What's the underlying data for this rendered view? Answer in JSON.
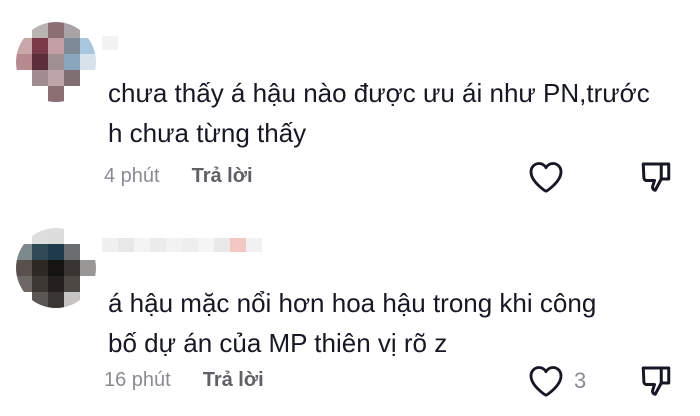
{
  "comments": [
    {
      "text_lines": [
        "chưa thấy á hậu nào được ưu ái như PN,trước",
        "h chưa từng thấy"
      ],
      "time": "4 phút",
      "reply_label": "Trả lời",
      "like_count": ""
    },
    {
      "text_lines": [
        "á hậu mặc nổi hơn hoa hậu trong khi công",
        "bố dự án của MP thiên vị rõ z"
      ],
      "time": "16 phút",
      "reply_label": "Trả lời",
      "like_count": "3"
    }
  ],
  "colors": {
    "text": "#161823",
    "meta": "#8a8b91",
    "reply": "#5f6066",
    "icon": "#161823"
  },
  "avatars": {
    "c1": [
      "#ffffff",
      "#b9b4b2",
      "#8d6f73",
      "#a9a2a6",
      "#ffffff",
      "#c9a6a8",
      "#7a3a48",
      "#c39ea4",
      "#7f8a99",
      "#a9c8e0",
      "#b68a8e",
      "#5c2e3a",
      "#9f8f93",
      "#8aa6bd",
      "#d7e2ea",
      "#ffffff",
      "#a08c91",
      "#bda4a8",
      "#7f6f73",
      "#ffffff",
      "#ffffff",
      "#ffffff",
      "#8c6f73",
      "#ffffff",
      "#ffffff"
    ],
    "c2": [
      "#ffffff",
      "#dedede",
      "#dcdcdc",
      "#ffffff",
      "#ffffff",
      "#7c8a8c",
      "#2f4a55",
      "#1f3a4a",
      "#6a6e70",
      "#ffffff",
      "#58504c",
      "#2e2825",
      "#161412",
      "#3a3432",
      "#9a9896",
      "#6c6866",
      "#3e3835",
      "#25201e",
      "#4e4845",
      "#ffffff",
      "#ffffff",
      "#5a5654",
      "#3a3634",
      "#c6c4c2",
      "#ffffff"
    ]
  },
  "usernames": {
    "c1": [
      "#f2f2f2",
      "#ffffff"
    ],
    "c2": [
      "#f0f0f0",
      "#e8e8e8",
      "#f4f4f4",
      "#ebebeb",
      "#f2f2f2",
      "#eeeeee",
      "#f5f5f5",
      "#e9e9e9",
      "#f3c8c4",
      "#f1f1f1"
    ]
  }
}
